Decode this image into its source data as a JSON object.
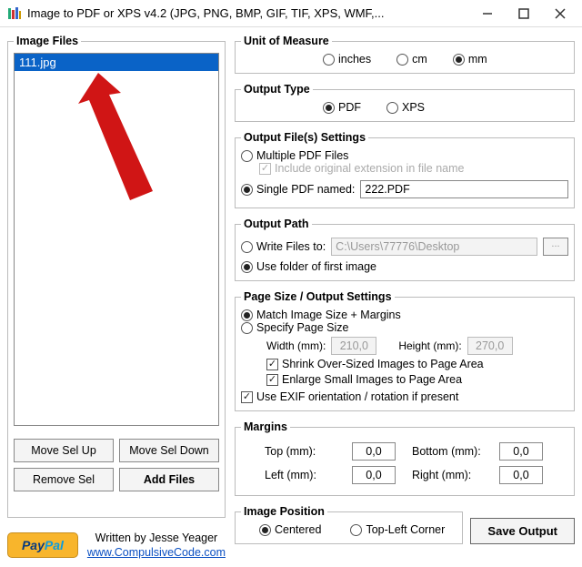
{
  "window": {
    "title": "Image to PDF or XPS  v4.2   (JPG, PNG, BMP, GIF, TIF, XPS, WMF,..."
  },
  "left": {
    "legend": "Image Files",
    "items": [
      "111.jpg"
    ],
    "move_up": "Move Sel Up",
    "move_down": "Move Sel Down",
    "remove": "Remove Sel",
    "add": "Add Files"
  },
  "unit": {
    "legend": "Unit of Measure",
    "inches": "inches",
    "cm": "cm",
    "mm": "mm",
    "selected": "mm"
  },
  "output_type": {
    "legend": "Output Type",
    "pdf": "PDF",
    "xps": "XPS",
    "selected": "pdf"
  },
  "output_files": {
    "legend": "Output File(s) Settings",
    "multiple": "Multiple PDF Files",
    "include_ext": "Include original extension in file name",
    "single_named": "Single PDF named:",
    "single_value": "222.PDF",
    "selected": "single"
  },
  "output_path": {
    "legend": "Output Path",
    "write_to": "Write Files to:",
    "write_value": "C:\\Users\\77776\\Desktop",
    "use_folder": "Use folder of first image",
    "selected": "use_folder"
  },
  "page_size": {
    "legend": "Page Size / Output Settings",
    "match": "Match Image Size + Margins",
    "specify": "Specify Page Size",
    "selected": "match",
    "width_label": "Width (mm):",
    "width_value": "210,0",
    "height_label": "Height (mm):",
    "height_value": "270,0",
    "shrink": "Shrink Over-Sized Images to Page Area",
    "enlarge": "Enlarge Small Images to Page Area",
    "exif": "Use EXIF orientation / rotation if present"
  },
  "margins": {
    "legend": "Margins",
    "top_label": "Top (mm):",
    "top_value": "0,0",
    "bottom_label": "Bottom (mm):",
    "bottom_value": "0,0",
    "left_label": "Left (mm):",
    "left_value": "0,0",
    "right_label": "Right (mm):",
    "right_value": "0,0"
  },
  "image_position": {
    "legend": "Image Position",
    "centered": "Centered",
    "topleft": "Top-Left Corner",
    "selected": "centered"
  },
  "footer": {
    "written_by": "Written by Jesse Yeager",
    "site": "www.CompulsiveCode.com",
    "save": "Save Output"
  }
}
